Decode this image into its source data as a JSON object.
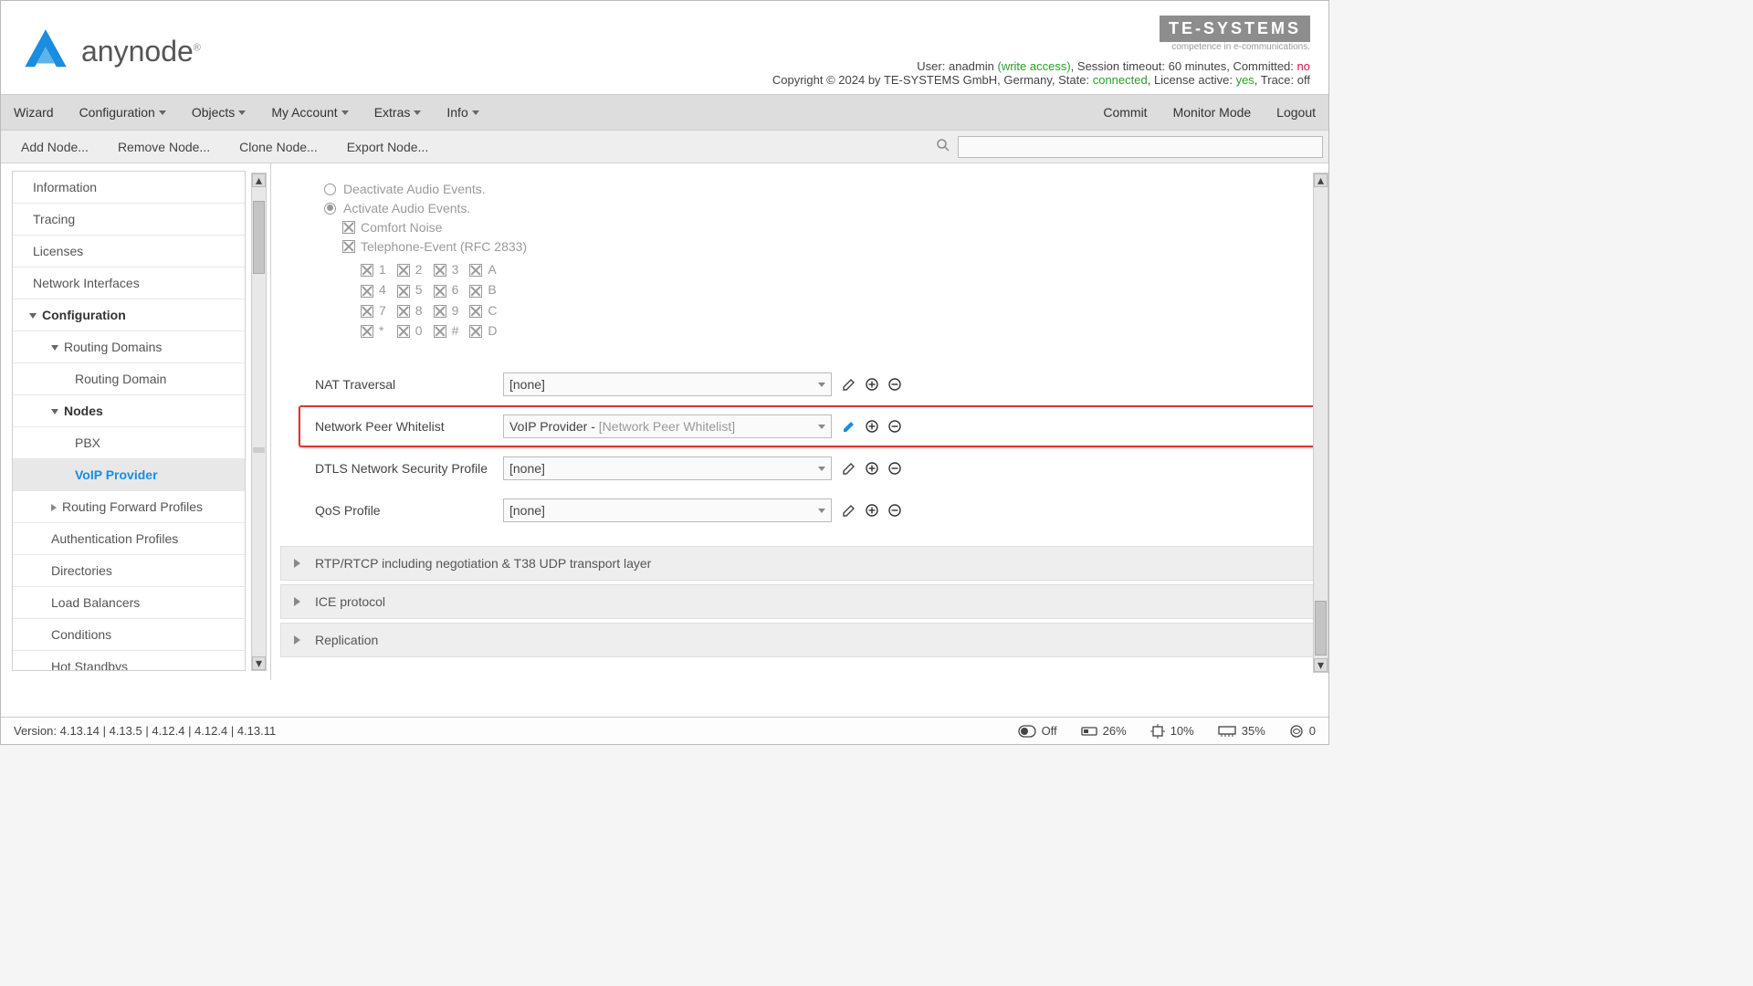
{
  "brand": {
    "name": "anynode",
    "partner": "TE-SYSTEMS",
    "partner_tag": "competence in e-communications."
  },
  "header": {
    "user_label": "User:",
    "user": "anadmin",
    "write_access": "(write access)",
    "session_label": ", Session timeout:",
    "session": "60 minutes",
    "committed_label": ", Committed:",
    "committed": "no",
    "copyright": "Copyright © 2024 by TE-SYSTEMS GmbH, Germany, ",
    "state_label": "State:",
    "state": "connected",
    "license_label": ", License active:",
    "license": "yes",
    "trace_label": ", Trace:",
    "trace": "off"
  },
  "menu": {
    "wizard": "Wizard",
    "configuration": "Configuration",
    "objects": "Objects",
    "myaccount": "My Account",
    "extras": "Extras",
    "info": "Info",
    "commit": "Commit",
    "monitor": "Monitor Mode",
    "logout": "Logout"
  },
  "submenu": {
    "add": "Add Node...",
    "remove": "Remove Node...",
    "clone": "Clone Node...",
    "export": "Export Node..."
  },
  "search_placeholder": "",
  "sidebar": {
    "information": "Information",
    "tracing": "Tracing",
    "licenses": "Licenses",
    "netif": "Network Interfaces",
    "configuration": "Configuration",
    "routingdomains": "Routing Domains",
    "routingdomain": "Routing Domain",
    "nodes": "Nodes",
    "pbx": "PBX",
    "voip": "VoIP Provider",
    "rfp": "Routing Forward Profiles",
    "auth": "Authentication Profiles",
    "dirs": "Directories",
    "lb": "Load Balancers",
    "cond": "Conditions",
    "hot": "Hot Standbys"
  },
  "audio": {
    "deactivate": "Deactivate Audio Events.",
    "activate": "Activate Audio Events.",
    "comfort": "Comfort Noise",
    "telephone": "Telephone-Event (RFC 2833)",
    "dtmf": [
      [
        "1",
        "2",
        "3",
        "A"
      ],
      [
        "4",
        "5",
        "6",
        "B"
      ],
      [
        "7",
        "8",
        "9",
        "C"
      ],
      [
        "*",
        "0",
        "#",
        "D"
      ]
    ]
  },
  "form": {
    "rows": {
      "nat": {
        "label": "NAT Traversal",
        "value": "[none]"
      },
      "peer": {
        "label": "Network Peer Whitelist",
        "value": "VoIP Provider - ",
        "sub": "[Network Peer Whitelist]"
      },
      "dtls": {
        "label": "DTLS Network Security Profile",
        "value": "[none]"
      },
      "qos": {
        "label": "QoS Profile",
        "value": "[none]"
      }
    }
  },
  "collapse": {
    "rtp": "RTP/RTCP including negotiation & T38 UDP transport layer",
    "ice": "ICE protocol",
    "repl": "Replication"
  },
  "footer": {
    "version_label": "Version:",
    "versions": "4.13.14 | 4.13.5 | 4.12.4 | 4.12.4 | 4.13.11",
    "off": "Off",
    "disk": "26%",
    "cpu": "10%",
    "mem": "35%",
    "conns": "0"
  }
}
